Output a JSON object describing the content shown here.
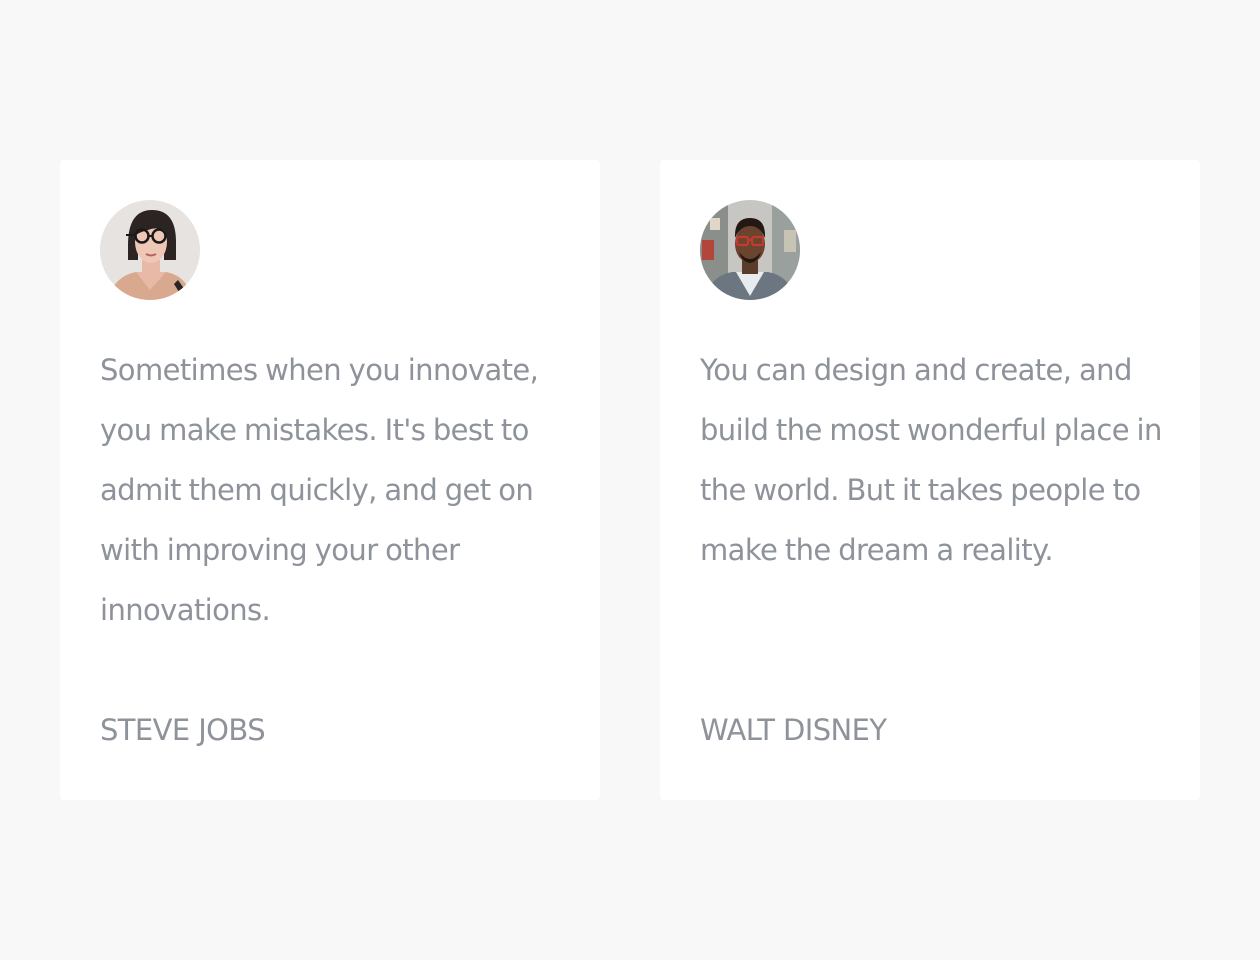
{
  "testimonials": [
    {
      "quote": "Sometimes when you innovate, you make mistakes. It's best to admit them quickly, and get on with improving your other innovations.",
      "author": "STEVE JOBS",
      "avatar_icon": "avatar-woman-glasses"
    },
    {
      "quote": "You can design and create, and build the most wonderful place in the world. But it takes people to make the dream a reality.",
      "author": "WALT DISNEY",
      "avatar_icon": "avatar-man-glasses"
    }
  ],
  "colors": {
    "page_background": "#f8f8f8",
    "card_background": "#ffffff",
    "text": "#8e929a"
  }
}
